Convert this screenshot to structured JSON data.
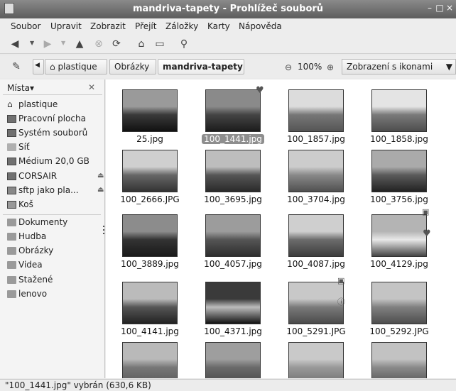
{
  "window": {
    "title": "mandriva-tapety - Prohlížeč souborů",
    "controls": [
      "–",
      "□",
      "×"
    ]
  },
  "menu": [
    {
      "label": "Soubor"
    },
    {
      "label": "Upravit"
    },
    {
      "label": "Zobrazit"
    },
    {
      "label": "Přejít"
    },
    {
      "label": "Záložky"
    },
    {
      "label": "Karty"
    },
    {
      "label": "Nápověda"
    }
  ],
  "toolbar": {
    "icons": [
      "back-icon",
      "forward-icon",
      "up-icon",
      "stop-icon",
      "reload-icon",
      "home-icon",
      "computer-icon",
      "search-icon"
    ]
  },
  "location": {
    "crumbs": [
      "plastique",
      "Obrázky",
      "mandriva-tapety"
    ],
    "zoom": "100%",
    "view_mode": "Zobrazení s ikonami"
  },
  "sidebar": {
    "header": "Místa",
    "items": [
      {
        "label": "plastique",
        "icon": "home-icon"
      },
      {
        "label": "Pracovní plocha",
        "icon": "desktop-icon"
      },
      {
        "label": "Systém souborů",
        "icon": "drive-icon"
      },
      {
        "label": "Síť",
        "icon": "network-icon"
      },
      {
        "label": "Médium 20,0 GB",
        "icon": "drive-icon"
      },
      {
        "label": "CORSAIR",
        "icon": "drive-icon"
      },
      {
        "label": "sftp jako pla...",
        "icon": "network-drive-icon"
      },
      {
        "label": "Koš",
        "icon": "trash-icon"
      }
    ],
    "bookmarks": [
      {
        "label": "Dokumenty"
      },
      {
        "label": "Hudba"
      },
      {
        "label": "Obrázky"
      },
      {
        "label": "Videa"
      },
      {
        "label": "Stažené"
      },
      {
        "label": "lenovo"
      }
    ]
  },
  "files": [
    {
      "name": "25.jpg",
      "colors": [
        "#9a9a9a",
        "#3a3a3a",
        "#111111"
      ]
    },
    {
      "name": "100_1441.jpg",
      "colors": [
        "#8a8a8a",
        "#444444",
        "#1c1c1c"
      ],
      "selected": true
    },
    {
      "name": "100_1857.jpg",
      "colors": [
        "#dcdcdc",
        "#777777",
        "#555555"
      ]
    },
    {
      "name": "100_1858.jpg",
      "colors": [
        "#e4e4e4",
        "#7a7a7a",
        "#4d4d4d"
      ]
    },
    {
      "name": "100_2666.JPG",
      "colors": [
        "#cfcfcf",
        "#666666",
        "#333333"
      ]
    },
    {
      "name": "100_3695.jpg",
      "colors": [
        "#bdbdbd",
        "#555555",
        "#2a2a2a"
      ]
    },
    {
      "name": "100_3704.jpg",
      "colors": [
        "#cccccc",
        "#888888",
        "#505050"
      ]
    },
    {
      "name": "100_3756.jpg",
      "colors": [
        "#aaaaaa",
        "#5a5a5a",
        "#222222"
      ]
    },
    {
      "name": "100_3889.jpg",
      "colors": [
        "#8c8c8c",
        "#333333",
        "#1a1a1a"
      ]
    },
    {
      "name": "100_4057.jpg",
      "colors": [
        "#9c9c9c",
        "#555555",
        "#2e2e2e"
      ]
    },
    {
      "name": "100_4087.jpg",
      "colors": [
        "#cfcfcf",
        "#6c6c6c",
        "#3c3c3c"
      ]
    },
    {
      "name": "100_4129.jpg",
      "colors": [
        "#b4b4b4",
        "#e8e8e8",
        "#444444"
      ]
    },
    {
      "name": "100_4141.jpg",
      "colors": [
        "#bbbbbb",
        "#555555",
        "#222222"
      ]
    },
    {
      "name": "100_4371.jpg",
      "colors": [
        "#3a3a3a",
        "#bcbcbc",
        "#111111"
      ]
    },
    {
      "name": "100_5291.JPG",
      "colors": [
        "#c8c8c8",
        "#7a7a7a",
        "#4a4a4a"
      ]
    },
    {
      "name": "100_5292.JPG",
      "colors": [
        "#c4c4c4",
        "#808080",
        "#4e4e4e"
      ]
    },
    {
      "name": "",
      "colors": [
        "#b9b9b9",
        "#777777",
        "#5a5a5a"
      ]
    },
    {
      "name": "",
      "colors": [
        "#9e9e9e",
        "#6a6a6a",
        "#4a4a4a"
      ]
    },
    {
      "name": "",
      "colors": [
        "#c9c9c9",
        "#999999",
        "#707070"
      ]
    },
    {
      "name": "",
      "colors": [
        "#c2c2c2",
        "#8a8a8a",
        "#555555"
      ]
    }
  ],
  "status": "\"100_1441.jpg\" vybrán (630,6 KB)"
}
